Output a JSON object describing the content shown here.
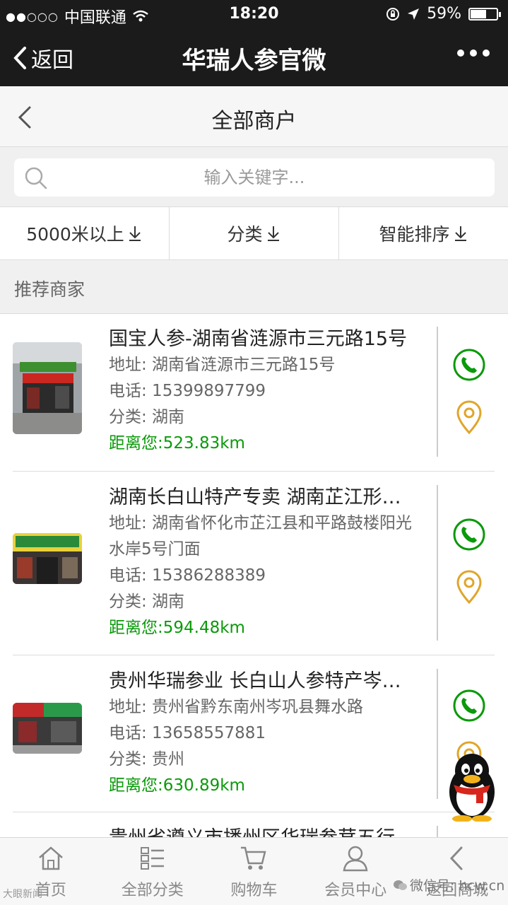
{
  "status_bar": {
    "signal": "●●○○○",
    "carrier": "中国联通",
    "time": "18:20",
    "battery": "59%"
  },
  "nav": {
    "back_label": "返回",
    "title": "华瑞人参官微"
  },
  "sub_header": {
    "title": "全部商户"
  },
  "search": {
    "placeholder": "输入关键字..."
  },
  "filters": [
    {
      "label": "5000米以上"
    },
    {
      "label": "分类"
    },
    {
      "label": "智能排序"
    }
  ],
  "section_title": "推荐商家",
  "merchants": [
    {
      "name": "国宝人参-湖南省涟源市三元路15号",
      "address": "地址: 湖南省涟源市三元路15号",
      "address2": "",
      "phone": "电话: 15399897799",
      "category": "分类: 湖南",
      "distance": "距离您:523.83km"
    },
    {
      "name": "湖南长白山特产专卖 湖南芷江形…",
      "address": "地址: 湖南省怀化市芷江县和平路鼓楼阳光",
      "address2": "水岸5号门面",
      "phone": "电话: 15386288389",
      "category": "分类: 湖南",
      "distance": "距离您:594.48km"
    },
    {
      "name": "贵州华瑞参业 长白山人参特产岑…",
      "address": "地址: 贵州省黔东南州岑巩县舞水路",
      "address2": "",
      "phone": "电话: 13658557881",
      "category": "分类: 贵州",
      "distance": "距离您:630.89km"
    },
    {
      "name": "贵州省遵义市播州区华瑞参茸五行",
      "address": "",
      "address2": "",
      "phone": "",
      "category": "",
      "distance": ""
    }
  ],
  "tabs": [
    {
      "label": "首页",
      "icon": "home-icon"
    },
    {
      "label": "全部分类",
      "icon": "category-icon"
    },
    {
      "label": "购物车",
      "icon": "cart-icon"
    },
    {
      "label": "会员中心",
      "icon": "user-icon"
    },
    {
      "label": "返回商城",
      "icon": "back-icon"
    }
  ],
  "watermarks": {
    "left": "大眼新闻",
    "right": "微信号: hcw.cn"
  },
  "colors": {
    "green": "#0a9a0a",
    "gold": "#e0a52a",
    "dark": "#1b1b1b"
  }
}
